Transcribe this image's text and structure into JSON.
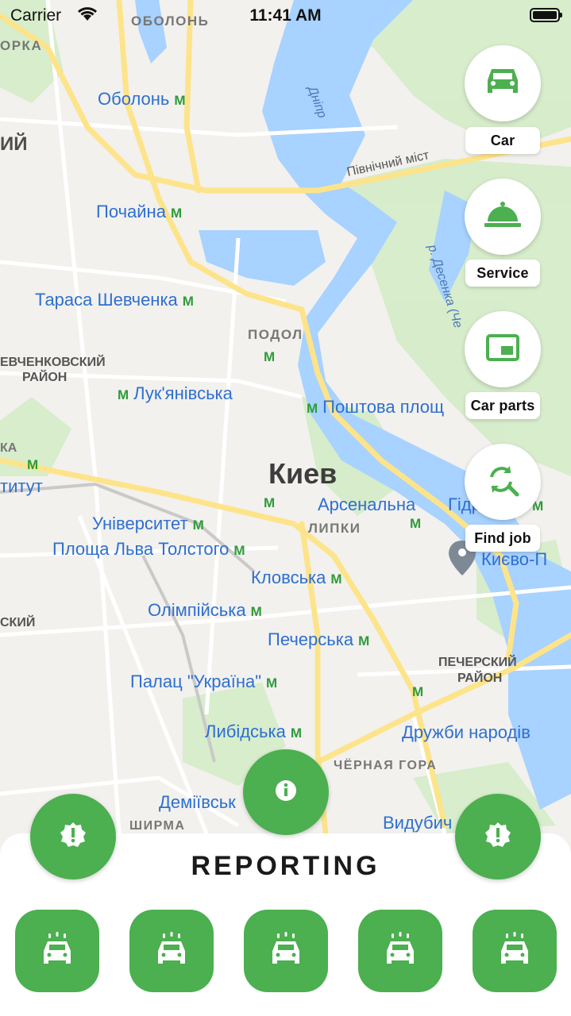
{
  "status_bar": {
    "carrier": "Carrier",
    "time": "11:41 AM"
  },
  "colors": {
    "accent": "#4caf50",
    "map_water": "#a8d2ff",
    "map_road": "#fde48a",
    "metro_label": "#2e6fd0",
    "metro_marker": "#2e9b3a"
  },
  "map": {
    "city": "Киев",
    "districts": [
      "ОБОЛОНЬ",
      "ОРКА",
      "ИЙ",
      "ПОДОЛ",
      "ЕВЧЕНКОВСКИЙ",
      "РАЙОН",
      "КА",
      "ЛИПКИ",
      "СКИЙ",
      "ПЕЧЕРСКИЙ",
      "РАЙОН",
      "ЧЁРНАЯ ГОРА",
      "ШИРМА"
    ],
    "stations": [
      "Оболонь",
      "Почайна",
      "Тараса Шевченка",
      "Лук'янівська",
      "Поштова площ",
      "Арсенальна",
      "Гідропарк",
      "Університет",
      "Площа Льва Толстого",
      "Кловська",
      "Олімпійська",
      "Печерська",
      "Палац \"Україна\"",
      "Либідська",
      "Дружби народів",
      "Деміївськ",
      "Видубич",
      "титут",
      "Києво-П"
    ],
    "features": [
      "Дніпр",
      "Північний міст",
      "р. Десенка (Че"
    ]
  },
  "side_actions": [
    {
      "label": "Car",
      "icon": "car-icon"
    },
    {
      "label": "Service",
      "icon": "cloche-icon"
    },
    {
      "label": "Car parts",
      "icon": "picture-in-picture-icon"
    },
    {
      "label": "Find job",
      "icon": "refresh-search-icon"
    }
  ],
  "info_button": {
    "icon": "info-icon"
  },
  "reporting": {
    "title": "REPORTING",
    "alert_icon": "alert-badge-icon",
    "buttons": [
      {
        "icon": "car-wash-icon"
      },
      {
        "icon": "car-wash-icon"
      },
      {
        "icon": "car-wash-icon"
      },
      {
        "icon": "car-wash-icon"
      },
      {
        "icon": "car-wash-icon"
      }
    ]
  }
}
